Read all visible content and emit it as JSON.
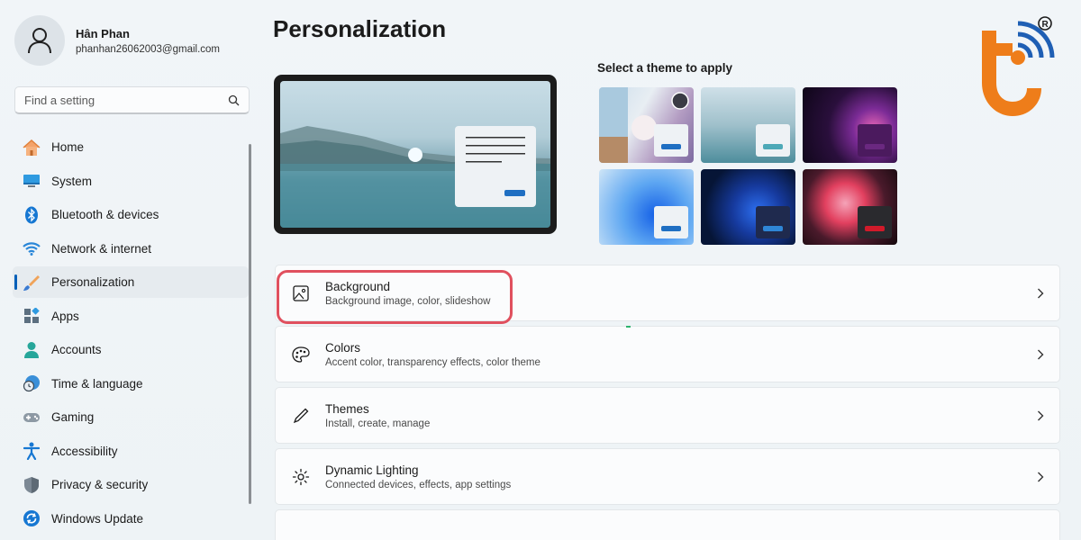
{
  "profile": {
    "name": "Hân Phan",
    "email": "phanhan26062003@gmail.com"
  },
  "search": {
    "placeholder": "Find a setting"
  },
  "nav": {
    "items": [
      {
        "label": "Home",
        "icon": "home-icon"
      },
      {
        "label": "System",
        "icon": "system-icon"
      },
      {
        "label": "Bluetooth & devices",
        "icon": "bluetooth-icon"
      },
      {
        "label": "Network & internet",
        "icon": "wifi-icon"
      },
      {
        "label": "Personalization",
        "icon": "brush-icon",
        "active": true
      },
      {
        "label": "Apps",
        "icon": "apps-icon"
      },
      {
        "label": "Accounts",
        "icon": "accounts-icon"
      },
      {
        "label": "Time & language",
        "icon": "clock-globe-icon"
      },
      {
        "label": "Gaming",
        "icon": "gamepad-icon"
      },
      {
        "label": "Accessibility",
        "icon": "accessibility-icon"
      },
      {
        "label": "Privacy & security",
        "icon": "shield-icon"
      },
      {
        "label": "Windows Update",
        "icon": "update-icon"
      }
    ]
  },
  "main": {
    "title": "Personalization",
    "theme_heading": "Select a theme to apply",
    "cards": [
      {
        "title": "Background",
        "subtitle": "Background image, color, slideshow",
        "icon": "image-icon"
      },
      {
        "title": "Colors",
        "subtitle": "Accent color, transparency effects, color theme",
        "icon": "palette-icon"
      },
      {
        "title": "Themes",
        "subtitle": "Install, create, manage",
        "icon": "pen-icon"
      },
      {
        "title": "Dynamic Lighting",
        "subtitle": "Connected devices, effects, app settings",
        "icon": "lighting-icon"
      }
    ]
  },
  "colors": {
    "accent": "#005fb8",
    "highlight": "#e0505e",
    "brand": "#ee7d1a"
  }
}
